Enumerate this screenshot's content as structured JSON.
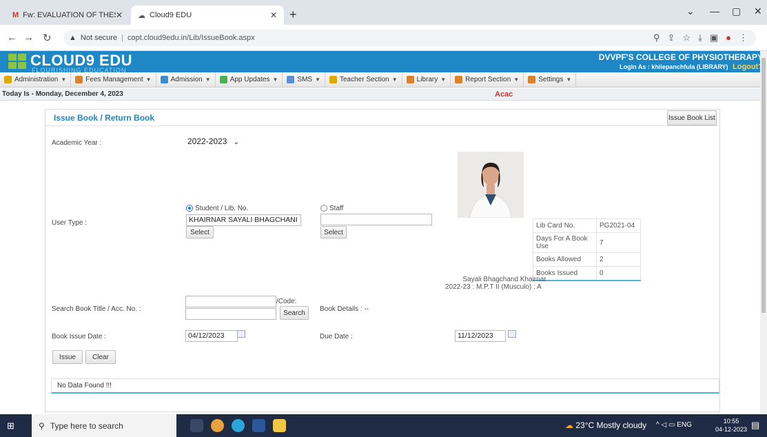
{
  "browser": {
    "tabs": [
      {
        "title": "Fw: EVALUATION OF THESIS SUB",
        "icon": "gmail-icon"
      },
      {
        "title": "Cloud9 EDU",
        "icon": "cloud-icon"
      }
    ],
    "new_tab": "+",
    "not_secure": "Not secure",
    "url": "copt.cloud9edu.in/Lib/IssueBook.aspx"
  },
  "header": {
    "brand": "CLOUD9 EDU",
    "tagline": "FLOURISHING EDUCATION",
    "college": "DVVPF'S COLLEGE OF PHYSIOTHERAPY",
    "login": "Login As : khilepanchfula (LIBRARY)",
    "logout": "Logout?"
  },
  "menu": [
    {
      "label": "Administration",
      "icon_color": "#e0a800"
    },
    {
      "label": "Fees Management",
      "icon_color": "#d9822b"
    },
    {
      "label": "Admission",
      "icon_color": "#3b8bd1"
    },
    {
      "label": "App Updates",
      "icon_color": "#4caf50"
    },
    {
      "label": "SMS",
      "icon_color": "#5b8fd6"
    },
    {
      "label": "Teacher Section",
      "icon_color": "#e0a800"
    },
    {
      "label": "Library",
      "icon_color": "#d9822b"
    },
    {
      "label": "Report Section",
      "icon_color": "#d9822b"
    },
    {
      "label": "Settings",
      "icon_color": "#d9822b"
    }
  ],
  "datebar": {
    "today": "Today Is - Monday, December 4, 2023",
    "marquee": "Acac"
  },
  "page": {
    "title": "Issue Book  / Return Book",
    "issue_list_btn": "Issue Book List",
    "academic_year_label": "Academic Year :",
    "academic_year_value": "2022-2023",
    "user_type_label": "User Type :",
    "student_radio": "Student / Lib. No.",
    "staff_radio": "Staff",
    "student_value": "KHAIRNAR SAYALI BHAGCHANI",
    "staff_value": "",
    "select_btn": "Select",
    "select_btn2": "Select",
    "info": [
      {
        "key": "Lib Card No.",
        "value": "PG2021-04"
      },
      {
        "key": "Days For A Book Use",
        "value": "7"
      },
      {
        "key": "Books Allowed",
        "value": "2"
      },
      {
        "key": "Books Issued",
        "value": "0"
      }
    ],
    "student_name": "Sayali Bhagchand Khairnar",
    "student_class": "2022-23 : M.P.T II (Musculo) : A",
    "search_label": "Search Book Title / Acc. No. :",
    "code_label": "/Code:",
    "search_btn": "Search",
    "book_details": "Book Details : --",
    "issue_date_label": "Book Issue Date :",
    "issue_date": "04/12/2023",
    "due_date_label": "Due Date :",
    "due_date": "11/12/2023",
    "issue_btn": "Issue",
    "clear_btn": "Clear",
    "no_data": "No Data Found !!!"
  },
  "taskbar": {
    "search_placeholder": "Type here to search",
    "weather": "23°C  Mostly cloudy",
    "lang": "ENG",
    "time": "10:55",
    "date": "04-12-2023"
  }
}
